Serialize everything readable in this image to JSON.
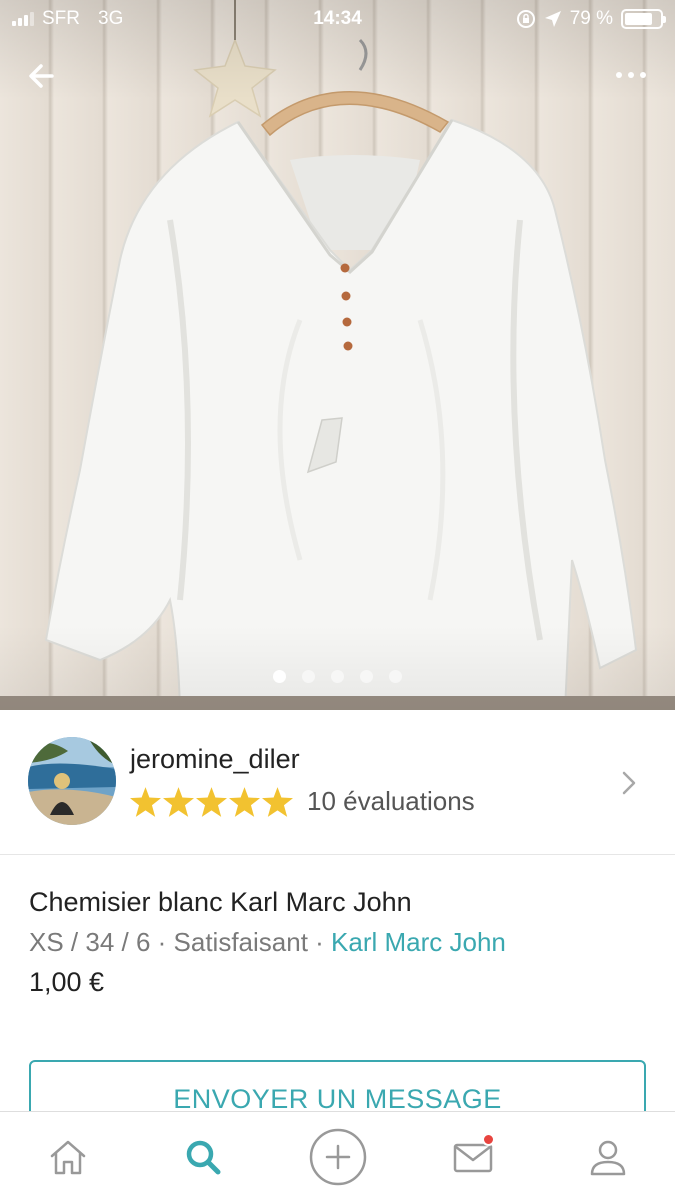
{
  "status_bar": {
    "carrier": "SFR",
    "network": "3G",
    "time": "14:34",
    "battery": "79 %",
    "battery_level": 0.79
  },
  "gallery": {
    "photo_count": 5,
    "active_index": 0
  },
  "seller": {
    "username": "jeromine_diler",
    "stars": 5,
    "reviews": "10 évaluations",
    "star_color": "#f2c230"
  },
  "item": {
    "title": "Chemisier blanc Karl Marc John",
    "meta": "XS / 34 / 6 · Satisfaisant · ",
    "brand": "Karl Marc John",
    "price": "1,00 €"
  },
  "actions": {
    "message_label": "ENVOYER UN MESSAGE"
  },
  "tabbar": {
    "items": [
      {
        "icon": "home-icon",
        "active": false
      },
      {
        "icon": "search-icon",
        "active": true
      },
      {
        "icon": "add-circle-icon",
        "active": false
      },
      {
        "icon": "mail-icon",
        "active": false,
        "badge": true
      },
      {
        "icon": "profile-icon",
        "active": false
      }
    ]
  },
  "colors": {
    "accent": "#3aa8b0",
    "badge": "#e8443f",
    "icon_inactive": "#999999"
  }
}
